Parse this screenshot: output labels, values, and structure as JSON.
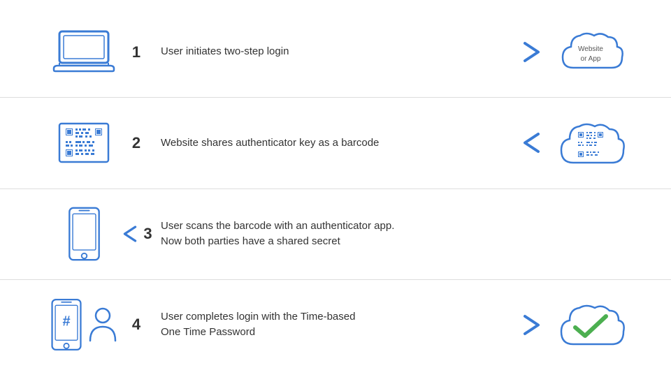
{
  "steps": [
    {
      "number": "1",
      "text": "User initiates two-step login",
      "text2": "",
      "arrow_direction": "right",
      "left_icon": "laptop",
      "right_icon": "cloud_empty",
      "right_label": "Website\nor App"
    },
    {
      "number": "2",
      "text": "Website shares authenticator key as a barcode",
      "text2": "",
      "arrow_direction": "left",
      "left_icon": "qr_screen",
      "right_icon": "cloud_qr",
      "right_label": ""
    },
    {
      "number": "3",
      "text": "User scans the barcode with an authenticator app.",
      "text2": "Now both parties have a shared secret",
      "arrow_direction": "left",
      "left_icon": "phone",
      "right_icon": "none",
      "right_label": ""
    },
    {
      "number": "4",
      "text": "User completes login with the Time-based",
      "text2": "One Time Password",
      "arrow_direction": "right",
      "left_icon": "phone_person",
      "right_icon": "cloud_check",
      "right_label": ""
    }
  ]
}
